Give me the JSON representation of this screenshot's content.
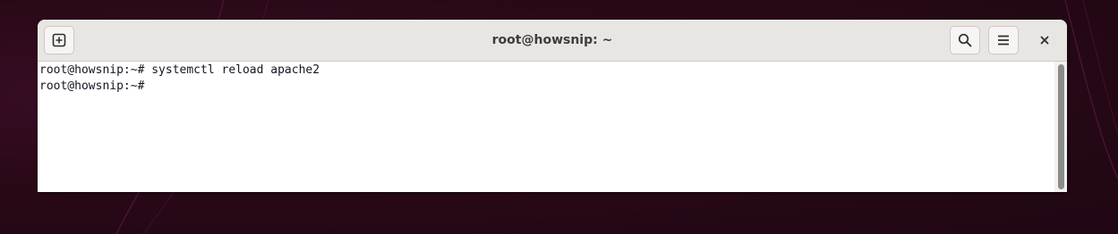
{
  "window": {
    "title": "root@howsnip: ~"
  },
  "titlebar": {
    "new_tab_icon": "new-tab-icon",
    "search_icon": "search-icon",
    "menu_icon": "hamburger-menu-icon",
    "close_icon": "close-icon"
  },
  "terminal": {
    "lines": [
      "root@howsnip:~# systemctl reload apache2",
      "root@howsnip:~# "
    ]
  },
  "colors": {
    "titlebar_bg": "#e8e6e3",
    "terminal_bg": "#ffffff",
    "terminal_fg": "#171421",
    "desktop_bg": "#2a0a1c"
  }
}
